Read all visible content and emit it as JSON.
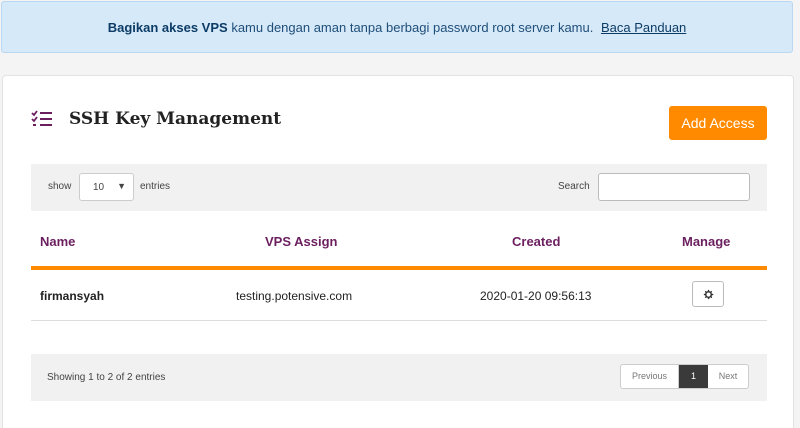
{
  "alert": {
    "bold": "Bagikan akses VPS",
    "text": "kamu dengan aman tanpa berbagi password root server kamu.",
    "link": "Baca Panduan"
  },
  "card": {
    "title": "SSH Key Management",
    "title_icon": "checklist-icon",
    "add_button": "Add Access"
  },
  "toolbar": {
    "show_label": "show",
    "entries_value": "10",
    "entries_label": "entries",
    "search_label": "Search",
    "search_value": ""
  },
  "table": {
    "headers": [
      "Name",
      "VPS Assign",
      "Created",
      "Manage"
    ],
    "rows": [
      {
        "name": "firmansyah",
        "vps": "testing.potensive.com",
        "created": "2020-01-20 09:56:13",
        "manage_icon": "gear-icon"
      }
    ]
  },
  "footer": {
    "info": "Showing 1 to 2 of 2 entries",
    "prev": "Previous",
    "current_page": "1",
    "next": "Next"
  },
  "colors": {
    "accent": "#ff8a00",
    "header_text": "#6b1f5f",
    "alert_bg": "#d6e9f8"
  }
}
